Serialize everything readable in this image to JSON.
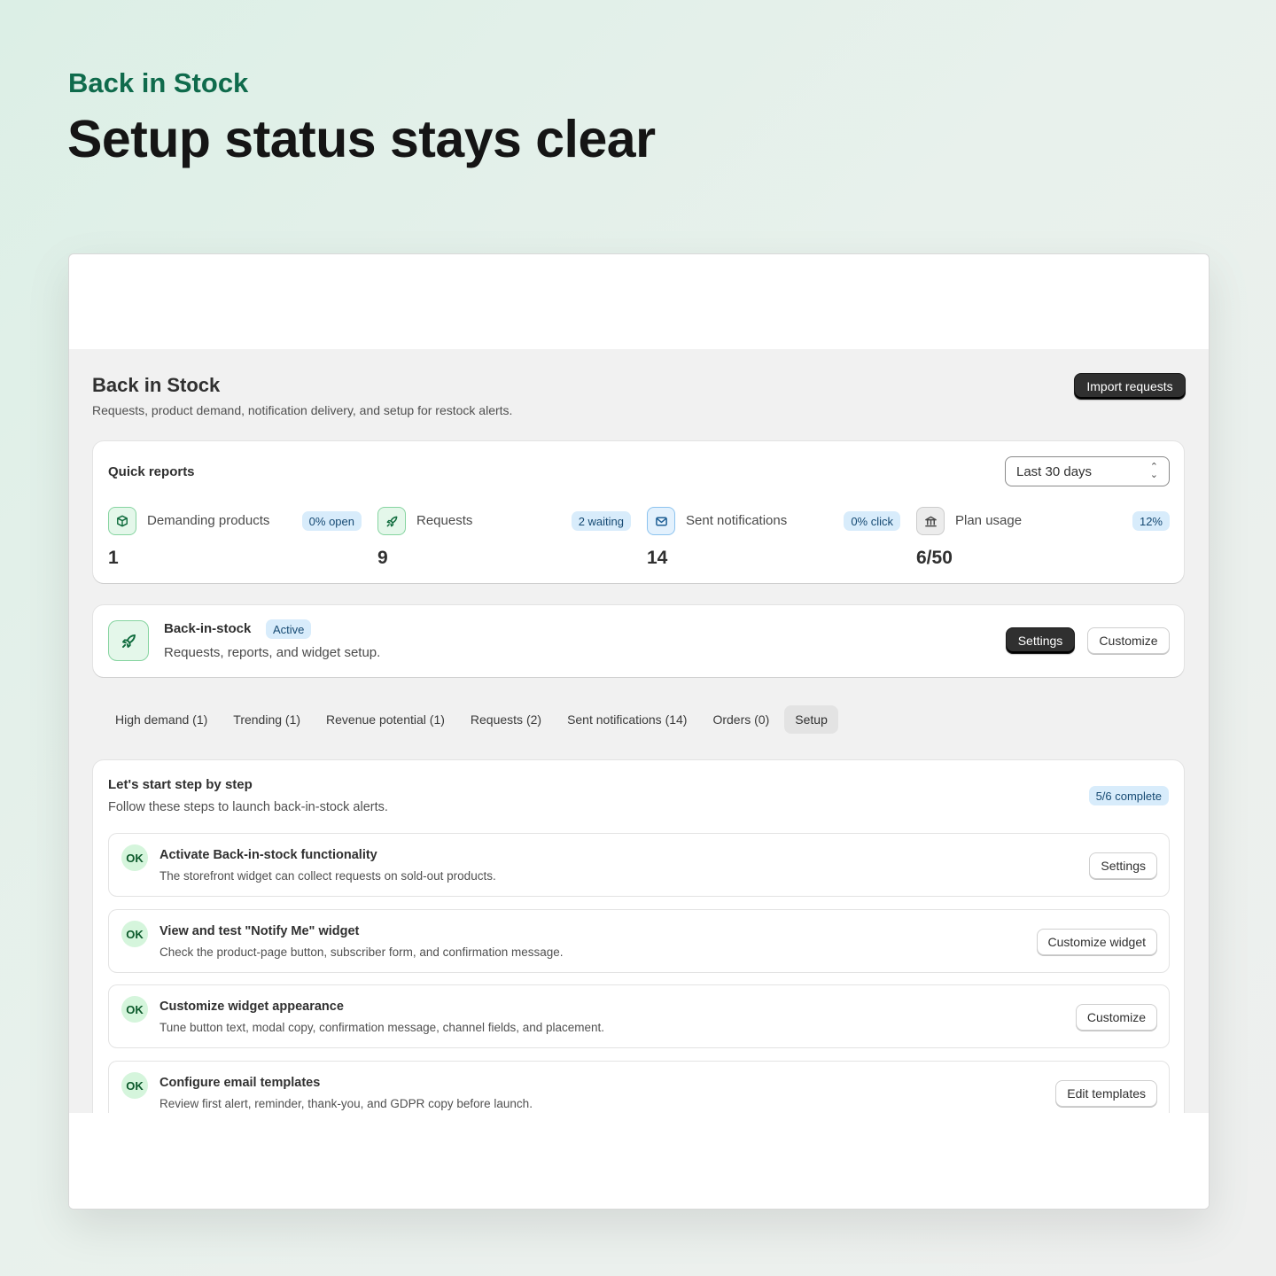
{
  "hero": {
    "eyebrow": "Back in Stock",
    "title": "Setup status stays clear"
  },
  "page": {
    "title": "Back in Stock",
    "subtitle": "Requests, product demand, notification delivery, and setup for restock alerts.",
    "import_label": "Import requests"
  },
  "reports": {
    "title": "Quick reports",
    "range": "Last 30 days",
    "metrics": [
      {
        "icon": "package-icon",
        "label": "Demanding products",
        "badge": "0% open",
        "value": "1"
      },
      {
        "icon": "rocket-icon",
        "label": "Requests",
        "badge": "2 waiting",
        "value": "9"
      },
      {
        "icon": "mail-icon",
        "label": "Sent notifications",
        "badge": "0% click",
        "value": "14"
      },
      {
        "icon": "bank-icon",
        "label": "Plan usage",
        "badge": "12%",
        "value": "6/50"
      }
    ]
  },
  "feature": {
    "icon": "rocket-icon",
    "title": "Back-in-stock",
    "status": "Active",
    "description": "Requests, reports, and widget setup.",
    "settings_label": "Settings",
    "customize_label": "Customize"
  },
  "tabs": [
    {
      "label": "High demand (1)"
    },
    {
      "label": "Trending (1)"
    },
    {
      "label": "Revenue potential (1)"
    },
    {
      "label": "Requests (2)"
    },
    {
      "label": "Sent notifications (14)"
    },
    {
      "label": "Orders (0)"
    },
    {
      "label": "Setup",
      "active": true
    }
  ],
  "setup": {
    "title": "Let's start step by step",
    "subtitle": "Follow these steps to launch back-in-stock alerts.",
    "progress": "5/6 complete",
    "steps": [
      {
        "status": "OK",
        "title": "Activate Back-in-stock functionality",
        "description": "The storefront widget can collect requests on sold-out products.",
        "action": "Settings"
      },
      {
        "status": "OK",
        "title": "View and test \"Notify Me\" widget",
        "description": "Check the product-page button, subscriber form, and confirmation message.",
        "action": "Customize widget"
      },
      {
        "status": "OK",
        "title": "Customize widget appearance",
        "description": "Tune button text, modal copy, confirmation message, channel fields, and placement.",
        "action": "Customize"
      },
      {
        "status": "OK",
        "title": "Configure email templates",
        "description": "Review first alert, reminder, thank-you, and GDPR copy before launch.",
        "action": "Edit templates"
      }
    ]
  },
  "colors": {
    "brand": "#0f6b4c",
    "dark_button": "#303030",
    "badge_bg": "#d8ecfb",
    "ok_bg": "#d5f5dc"
  }
}
